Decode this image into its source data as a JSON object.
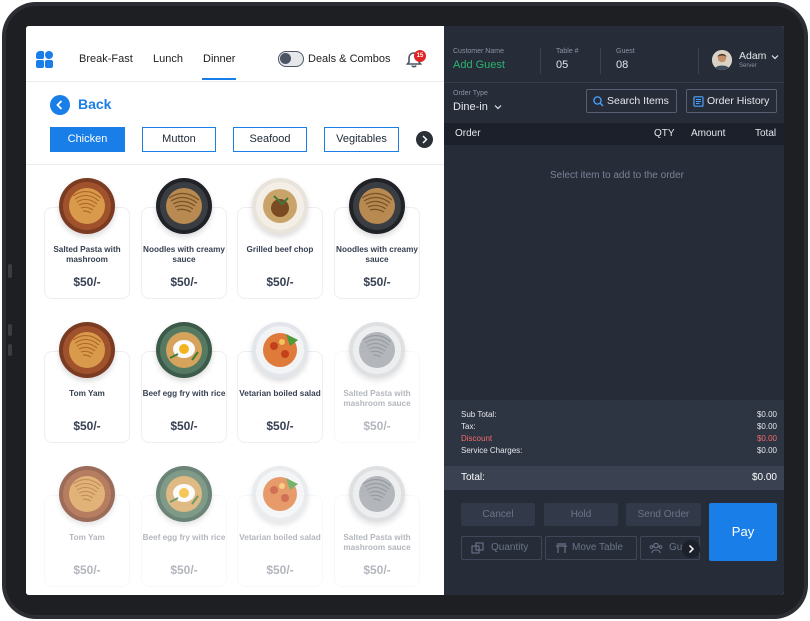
{
  "nav": {
    "tabs": [
      {
        "label": "Break-Fast"
      },
      {
        "label": "Lunch"
      },
      {
        "label": "Dinner"
      }
    ],
    "deals_label": "Deals & Combos",
    "notification_count": "15"
  },
  "back_label": "Back",
  "categories": [
    "Chicken",
    "Mutton",
    "Seafood",
    "Vegitables"
  ],
  "menu": [
    {
      "name": "Salted Pasta with mashroom",
      "price": "$50/-"
    },
    {
      "name": "Noodles with creamy sauce",
      "price": "$50/-"
    },
    {
      "name": "Grilled beef chop",
      "price": "$50/-"
    },
    {
      "name": "Noodles with creamy sauce",
      "price": "$50/-"
    },
    {
      "name": "Tom Yam",
      "price": "$50/-"
    },
    {
      "name": "Beef egg fry with rice",
      "price": "$50/-"
    },
    {
      "name": "Vetarian boiled salad",
      "price": "$50/-"
    },
    {
      "name": "Salted Pasta with mashroom sauce",
      "price": "$50/-"
    },
    {
      "name": "Tom Yam",
      "price": "$50/-"
    },
    {
      "name": "Beef egg fry with rice",
      "price": "$50/-"
    },
    {
      "name": "Vetarian boiled salad",
      "price": "$50/-"
    },
    {
      "name": "Salted Pasta with mashroom sauce",
      "price": "$50/-"
    }
  ],
  "order_panel": {
    "customer_label": "Customer Name",
    "customer_value": "Add Guest",
    "table_label": "Table #",
    "table_value": "05",
    "guest_label": "Guest",
    "guest_value": "08",
    "user_name": "Adam",
    "user_role": "Server",
    "order_type_label": "Order Type",
    "order_type_value": "Dine-in",
    "search_items_label": "Search Items",
    "order_history_label": "Order History",
    "columns": {
      "order": "Order",
      "qty": "QTY",
      "amount": "Amount",
      "total": "Total"
    },
    "empty_message": "Select item to add to the order",
    "summary": [
      {
        "label": "Sub Total:",
        "value": "$0.00"
      },
      {
        "label": "Tax:",
        "value": "$0.00"
      },
      {
        "label": "Discount",
        "value": "$0.00"
      },
      {
        "label": "Service Charges:",
        "value": "$0.00"
      }
    ],
    "total_label": "Total:",
    "total_value": "$0.00",
    "cancel_label": "Cancel",
    "hold_label": "Hold",
    "send_order_label": "Send Order",
    "quantity_label": "Quantity",
    "move_table_label": "Move Table",
    "guest_btn_label": "Gu",
    "pay_label": "Pay"
  },
  "colors": {
    "accent": "#1a7ee8",
    "panel": "#262c38",
    "discount": "#f26b6b",
    "badge": "#e02424"
  }
}
